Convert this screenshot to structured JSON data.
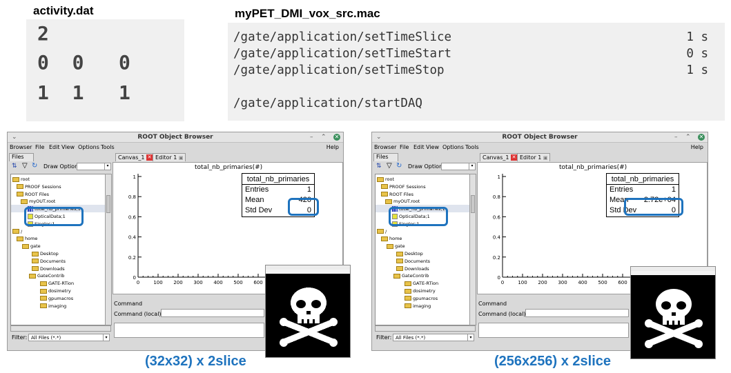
{
  "activity": {
    "title": "activity.dat",
    "lines": [
      "2",
      "0  0   0",
      "1  1   1"
    ]
  },
  "mac": {
    "title": "myPET_DMI_vox_src.mac",
    "commands": [
      {
        "cmd": "/gate/application/setTimeSlice",
        "val": "1 s"
      },
      {
        "cmd": "/gate/application/setTimeStart",
        "val": "0 s"
      },
      {
        "cmd": "/gate/application/setTimeStop",
        "val": "1 s"
      },
      {
        "cmd": "/gate/application/startDAQ",
        "val": ""
      }
    ]
  },
  "browser": {
    "title": "ROOT Object Browser",
    "menu": [
      "Browser",
      "File",
      "Edit",
      "View",
      "Options",
      "Tools"
    ],
    "help": "Help",
    "files_tab": "Files",
    "draw_option_label": "Draw Option:",
    "tree": [
      {
        "label": "root",
        "kind": "folder"
      },
      {
        "label": "PROOF Sessions",
        "kind": "folder"
      },
      {
        "label": "ROOT Files",
        "kind": "folder"
      },
      {
        "label": "myOUT.root",
        "kind": "file"
      },
      {
        "label": "total_nb_primaries;1",
        "kind": "histo"
      },
      {
        "label": "OpticalData;1",
        "kind": "leaf"
      },
      {
        "label": "Singles;1",
        "kind": "leaf"
      },
      {
        "label": "/",
        "kind": "folder"
      },
      {
        "label": "home",
        "kind": "folder"
      },
      {
        "label": "gate",
        "kind": "folder"
      },
      {
        "label": "Desktop",
        "kind": "folder"
      },
      {
        "label": "Documents",
        "kind": "folder"
      },
      {
        "label": "Downloads",
        "kind": "folder"
      },
      {
        "label": "GateContrib",
        "kind": "folder"
      },
      {
        "label": "GATE-RTion",
        "kind": "folder"
      },
      {
        "label": "dosimetry",
        "kind": "folder"
      },
      {
        "label": "gpumacros",
        "kind": "folder"
      },
      {
        "label": "imaging",
        "kind": "folder"
      }
    ],
    "filter_label": "Filter:",
    "filter_value": "All Files (*.*)",
    "canvas_tab": "Canvas_1",
    "editor_tab": "Editor 1",
    "canvas_title": "total_nb_primaries(#)",
    "y_ticks": [
      "1",
      "0.8",
      "0.6",
      "0.4",
      "0.2",
      "0"
    ],
    "x_ticks": [
      "0",
      "100",
      "200",
      "300",
      "400",
      "500",
      "600"
    ],
    "command_tab": "Command",
    "command_label": "Command (local):",
    "stats_title": "total_nb_primaries",
    "stats_labels": [
      "Entries",
      "Mean",
      "Std Dev"
    ]
  },
  "panels": [
    {
      "entries": "1",
      "mean": "420",
      "stddev": "0",
      "caption": "(32x32) x 2slice"
    },
    {
      "entries": "1",
      "mean": "2.72e+04",
      "stddev": "0",
      "caption": "(256x256) x 2slice"
    }
  ],
  "colors": {
    "highlight": "#1e73be",
    "caption": "#1e73be"
  }
}
